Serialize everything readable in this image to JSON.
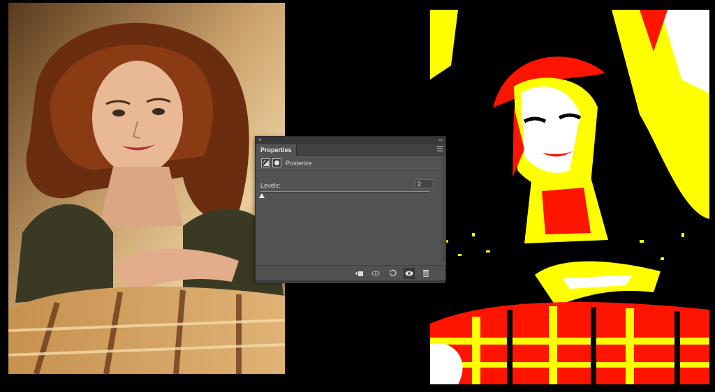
{
  "panel": {
    "close_glyph": "×",
    "collapse_glyph": "‹‹",
    "tab_label": "Properties",
    "menu_icon": "hamburger-icon",
    "adjustment": {
      "icon": "posterize-icon",
      "mask_icon": "mask-icon",
      "title": "Posterize"
    },
    "levels": {
      "label": "Levels:",
      "value": "2",
      "slider_fraction": 0.0
    },
    "footer": {
      "buttons": [
        "clip-to-layer-icon",
        "view-previous-state-icon",
        "reset-icon",
        "visibility-eye-icon",
        "trash-icon"
      ]
    }
  },
  "colors": {
    "panel_bg": "#535353",
    "poster_red": "#ff1400",
    "poster_yellow": "#ffff00",
    "poster_white": "#ffffff",
    "poster_black": "#000000"
  }
}
